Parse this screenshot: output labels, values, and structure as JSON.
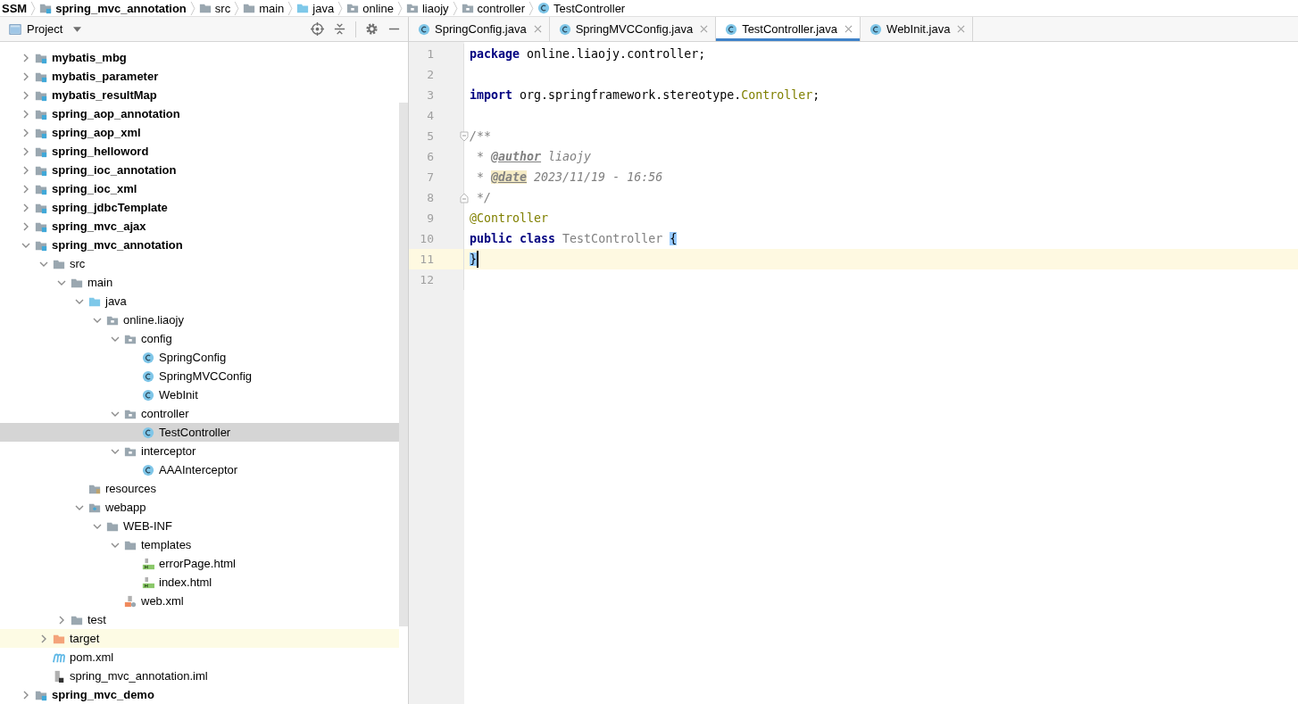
{
  "breadcrumb": [
    {
      "label": "SSM",
      "kind": "project"
    },
    {
      "label": "spring_mvc_annotation",
      "kind": "module"
    },
    {
      "label": "src",
      "kind": "folder"
    },
    {
      "label": "main",
      "kind": "folder"
    },
    {
      "label": "java",
      "kind": "source"
    },
    {
      "label": "online",
      "kind": "package"
    },
    {
      "label": "liaojy",
      "kind": "package"
    },
    {
      "label": "controller",
      "kind": "package"
    },
    {
      "label": "TestController",
      "kind": "class"
    }
  ],
  "project_panel": {
    "title": "Project",
    "tree": [
      {
        "label": "mybatis_mbg",
        "kind": "module",
        "expanded": false,
        "selected": false,
        "highlighted": false
      },
      {
        "label": "mybatis_parameter",
        "kind": "module",
        "expanded": false,
        "selected": false,
        "highlighted": false
      },
      {
        "label": "mybatis_resultMap",
        "kind": "module",
        "expanded": false,
        "selected": false,
        "highlighted": false
      },
      {
        "label": "spring_aop_annotation",
        "kind": "module",
        "expanded": false,
        "selected": false,
        "highlighted": false
      },
      {
        "label": "spring_aop_xml",
        "kind": "module",
        "expanded": false,
        "selected": false,
        "highlighted": false
      },
      {
        "label": "spring_helloword",
        "kind": "module",
        "expanded": false,
        "selected": false,
        "highlighted": false
      },
      {
        "label": "spring_ioc_annotation",
        "kind": "module",
        "expanded": false,
        "selected": false,
        "highlighted": false
      },
      {
        "label": "spring_ioc_xml",
        "kind": "module",
        "expanded": false,
        "selected": false,
        "highlighted": false
      },
      {
        "label": "spring_jdbcTemplate",
        "kind": "module",
        "expanded": false,
        "selected": false,
        "highlighted": false
      },
      {
        "label": "spring_mvc_ajax",
        "kind": "module",
        "expanded": false,
        "selected": false,
        "highlighted": false
      },
      {
        "label": "spring_mvc_annotation",
        "kind": "module",
        "expanded": true,
        "selected": false,
        "highlighted": false,
        "children": [
          {
            "label": "src",
            "kind": "folder",
            "expanded": true,
            "selected": false,
            "highlighted": false,
            "children": [
              {
                "label": "main",
                "kind": "folder",
                "expanded": true,
                "selected": false,
                "highlighted": false,
                "children": [
                  {
                    "label": "java",
                    "kind": "source",
                    "expanded": true,
                    "selected": false,
                    "highlighted": false,
                    "children": [
                      {
                        "label": "online.liaojy",
                        "kind": "package",
                        "expanded": true,
                        "selected": false,
                        "highlighted": false,
                        "children": [
                          {
                            "label": "config",
                            "kind": "package",
                            "expanded": true,
                            "selected": false,
                            "highlighted": false,
                            "children": [
                              {
                                "label": "SpringConfig",
                                "kind": "class",
                                "selected": false,
                                "highlighted": false
                              },
                              {
                                "label": "SpringMVCConfig",
                                "kind": "class",
                                "selected": false,
                                "highlighted": false
                              },
                              {
                                "label": "WebInit",
                                "kind": "class",
                                "selected": false,
                                "highlighted": false
                              }
                            ]
                          },
                          {
                            "label": "controller",
                            "kind": "package",
                            "expanded": true,
                            "selected": false,
                            "highlighted": false,
                            "children": [
                              {
                                "label": "TestController",
                                "kind": "class",
                                "selected": true,
                                "highlighted": false
                              }
                            ]
                          },
                          {
                            "label": "interceptor",
                            "kind": "package",
                            "expanded": true,
                            "selected": false,
                            "highlighted": false,
                            "children": [
                              {
                                "label": "AAAInterceptor",
                                "kind": "class",
                                "selected": false,
                                "highlighted": false
                              }
                            ]
                          }
                        ]
                      }
                    ]
                  },
                  {
                    "label": "resources",
                    "kind": "resources",
                    "selected": false,
                    "highlighted": false
                  },
                  {
                    "label": "webapp",
                    "kind": "webapp",
                    "expanded": true,
                    "selected": false,
                    "highlighted": false,
                    "children": [
                      {
                        "label": "WEB-INF",
                        "kind": "folder",
                        "expanded": true,
                        "selected": false,
                        "highlighted": false,
                        "children": [
                          {
                            "label": "templates",
                            "kind": "folder",
                            "expanded": true,
                            "selected": false,
                            "highlighted": false,
                            "children": [
                              {
                                "label": "errorPage.html",
                                "kind": "html",
                                "selected": false,
                                "highlighted": false
                              },
                              {
                                "label": "index.html",
                                "kind": "html",
                                "selected": false,
                                "highlighted": false
                              }
                            ]
                          },
                          {
                            "label": "web.xml",
                            "kind": "xml",
                            "selected": false,
                            "highlighted": false
                          }
                        ]
                      }
                    ]
                  }
                ]
              },
              {
                "label": "test",
                "kind": "folder",
                "expanded": false,
                "selected": false,
                "highlighted": false
              }
            ]
          },
          {
            "label": "target",
            "kind": "excluded",
            "expanded": false,
            "selected": false,
            "highlighted": true
          },
          {
            "label": "pom.xml",
            "kind": "maven",
            "selected": false,
            "highlighted": false
          },
          {
            "label": "spring_mvc_annotation.iml",
            "kind": "iml",
            "selected": false,
            "highlighted": false
          }
        ]
      },
      {
        "label": "spring_mvc_demo",
        "kind": "module",
        "expanded": false,
        "selected": false,
        "highlighted": false
      }
    ]
  },
  "tabs": [
    {
      "label": "SpringConfig.java",
      "selected": false
    },
    {
      "label": "SpringMVCConfig.java",
      "selected": false
    },
    {
      "label": "TestController.java",
      "selected": true
    },
    {
      "label": "WebInit.java",
      "selected": false
    }
  ],
  "editor": {
    "lines": [
      {
        "number": "1",
        "current": false,
        "tokens": [
          {
            "kind": "keyword",
            "text": "package"
          },
          {
            "kind": "plain",
            "text": " online.liaojy.controller;"
          }
        ]
      },
      {
        "number": "2",
        "current": false
      },
      {
        "number": "3",
        "current": false,
        "tokens": [
          {
            "kind": "keyword",
            "text": "import"
          },
          {
            "kind": "plain",
            "text": " org.springframework.stereotype."
          },
          {
            "kind": "annotation",
            "text": "Controller"
          },
          {
            "kind": "plain",
            "text": ";"
          }
        ]
      },
      {
        "number": "4",
        "current": false
      },
      {
        "number": "5",
        "current": false,
        "fold_start": true,
        "tokens": [
          {
            "kind": "comment",
            "text": "/**"
          }
        ]
      },
      {
        "number": "6",
        "current": false,
        "tokens": [
          {
            "kind": "comment",
            "text": " * "
          },
          {
            "kind": "doctag",
            "text": "@author"
          },
          {
            "kind": "comment",
            "text": " liaojy"
          }
        ]
      },
      {
        "number": "7",
        "current": false,
        "tokens": [
          {
            "kind": "comment",
            "text": " * "
          },
          {
            "kind": "doctag-hl",
            "text": "@date"
          },
          {
            "kind": "comment",
            "text": " 2023/11/19 - 16:56"
          }
        ]
      },
      {
        "number": "8",
        "current": false,
        "fold_end": true,
        "tokens": [
          {
            "kind": "comment",
            "text": " */"
          }
        ]
      },
      {
        "number": "9",
        "current": false,
        "tokens": [
          {
            "kind": "annotation",
            "text": "@Controller"
          }
        ]
      },
      {
        "number": "10",
        "current": false,
        "tokens": [
          {
            "kind": "keyword",
            "text": "public"
          },
          {
            "kind": "keyword",
            "text": " class"
          },
          {
            "kind": "unused",
            "text": " TestController "
          },
          {
            "kind": "brace",
            "text": "{"
          }
        ]
      },
      {
        "number": "11",
        "current": true,
        "tokens": [
          {
            "kind": "brace",
            "text": "}"
          }
        ]
      },
      {
        "number": "12",
        "current": false
      }
    ]
  }
}
